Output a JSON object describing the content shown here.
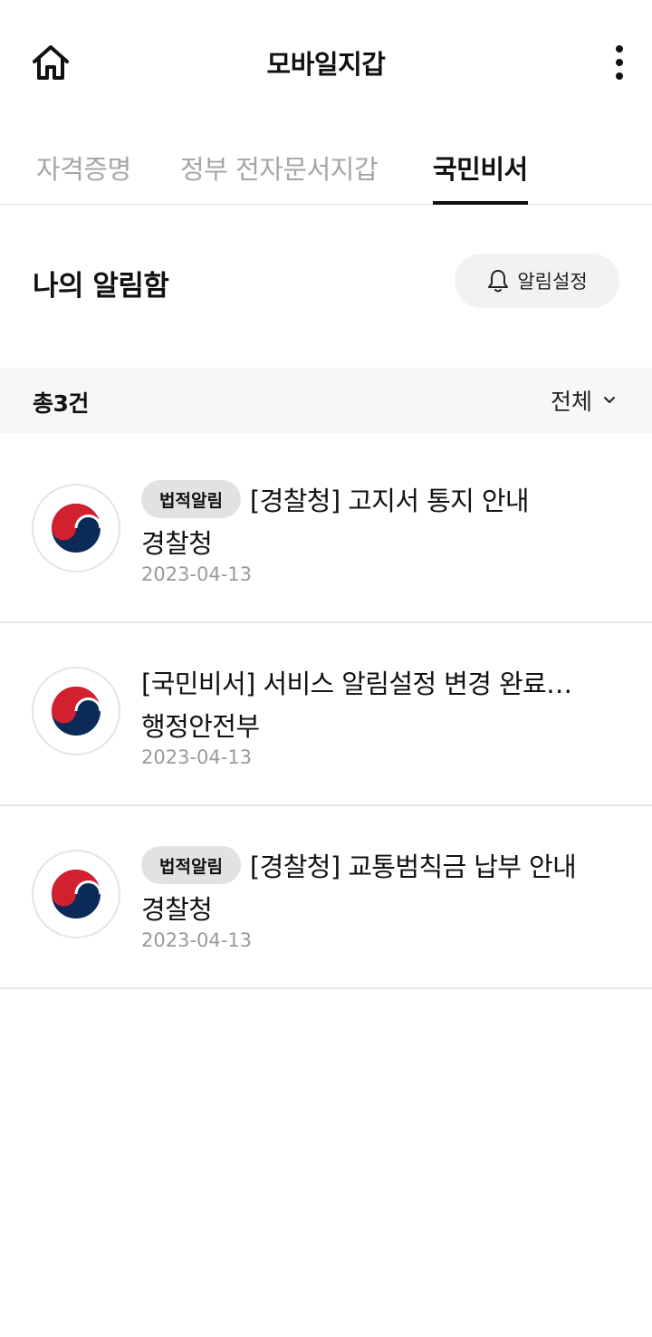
{
  "header": {
    "home_icon": "home-icon",
    "title": "모바일지갑",
    "more_icon": "more-vertical-icon"
  },
  "tabs": [
    {
      "label": "자격증명",
      "active": false
    },
    {
      "label": "정부 전자문서지갑",
      "active": false
    },
    {
      "label": "국민비서",
      "active": true
    }
  ],
  "inbox": {
    "title": "나의 알림함",
    "settings_label": "알림설정",
    "settings_icon": "bell-icon"
  },
  "summary": {
    "total": "총3건",
    "filter_value": "전체",
    "filter_icon": "chevron-down-icon"
  },
  "notifications": [
    {
      "badge": "법적알림",
      "title": "[경찰청] 고지서 통지 안내",
      "sender": "경찰청",
      "date": "2023-04-13",
      "icon": "government-emblem-icon"
    },
    {
      "badge": "",
      "title": "[국민비서] 서비스 알림설정 변경 완료…",
      "sender": "행정안전부",
      "date": "2023-04-13",
      "icon": "government-emblem-icon"
    },
    {
      "badge": "법적알림",
      "title": "[경찰청] 교통범칙금 납부 안내",
      "sender": "경찰청",
      "date": "2023-04-13",
      "icon": "government-emblem-icon"
    }
  ],
  "colors": {
    "emblem_blue": "#0b2a58",
    "emblem_red": "#d2202f",
    "summary_bg": "#f6f7f9",
    "badge_bg": "#e2e2e2"
  }
}
